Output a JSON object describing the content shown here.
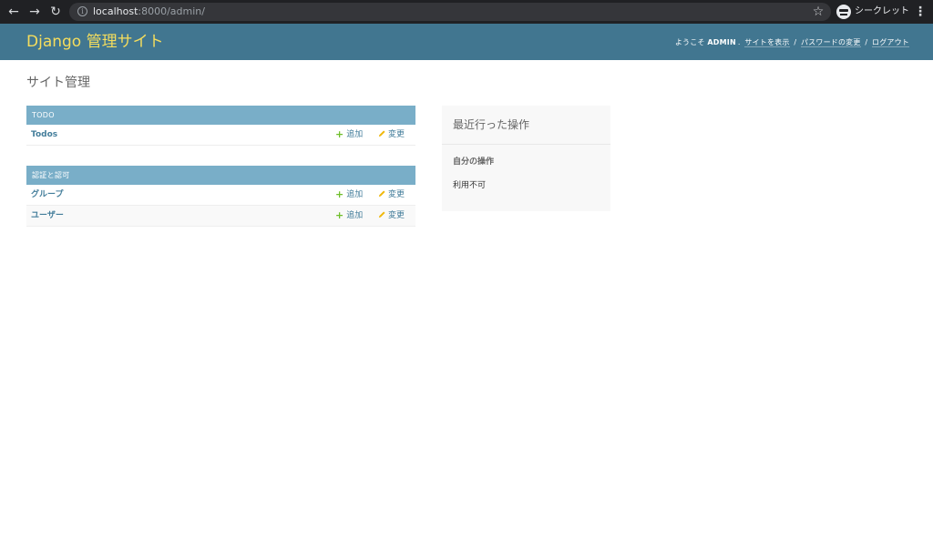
{
  "browser": {
    "url_host": "localhost",
    "url_path": ":8000/admin/",
    "profile_label": "シークレット",
    "icons": {
      "back": "back-arrow-icon",
      "forward": "forward-arrow-icon",
      "reload": "reload-icon",
      "info": "info-icon",
      "star": "star-icon",
      "incognito": "incognito-icon",
      "menu": "kebab-menu-icon"
    }
  },
  "header": {
    "branding": "Django 管理サイト",
    "welcome": "ようこそ",
    "username": "ADMIN",
    "links": {
      "view_site": "サイトを表示",
      "password_change": "パスワードの変更",
      "logout": "ログアウト"
    },
    "colors": {
      "background": "#417690",
      "branding": "#f5dd5d"
    }
  },
  "content": {
    "title": "サイト管理",
    "modules": [
      {
        "caption": "TODO",
        "rows": [
          {
            "name": "Todos",
            "add": "追加",
            "change": "変更"
          }
        ]
      },
      {
        "caption": "認証と認可",
        "rows": [
          {
            "name": "グループ",
            "add": "追加",
            "change": "変更"
          },
          {
            "name": "ユーザー",
            "add": "追加",
            "change": "変更"
          }
        ]
      }
    ],
    "colors": {
      "caption_bg": "#79aec8",
      "link": "#447e9b",
      "add_icon": "#70bf2b",
      "change_icon": "#efb80b"
    }
  },
  "recent_actions": {
    "title": "最近行った操作",
    "subtitle": "自分の操作",
    "empty": "利用不可"
  }
}
